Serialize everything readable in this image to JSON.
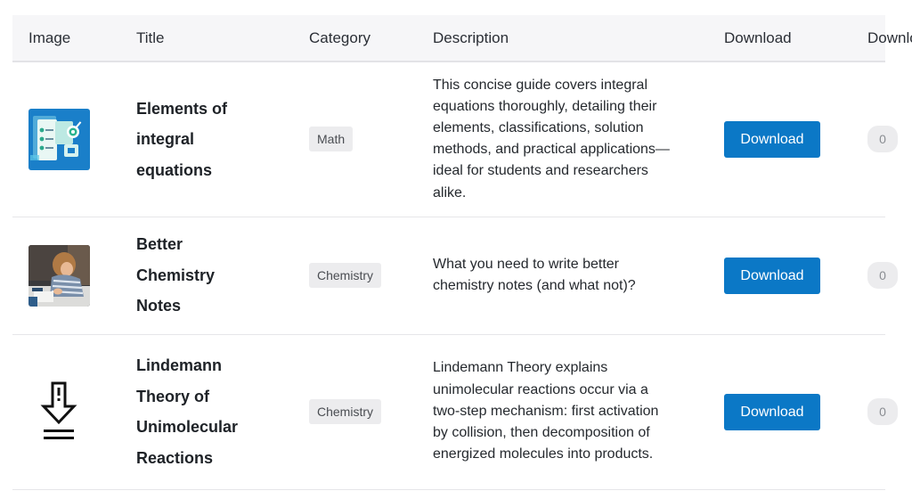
{
  "table": {
    "headers": {
      "image": "Image",
      "title": "Title",
      "category": "Category",
      "description": "Description",
      "download": "Download",
      "downloads": "Downloads"
    },
    "rows": [
      {
        "image_icon": "infographic-thumbnail",
        "title": "Elements of integral equations",
        "category": "Math",
        "description": "This concise guide covers integral equations thoroughly, detailing their elements, classifications, solution methods, and practical applications—ideal for students and researchers alike.",
        "download_label": "Download",
        "downloads": "0"
      },
      {
        "image_icon": "child-writing-photo-thumbnail",
        "title": "Better Chemistry Notes",
        "category": "Chemistry",
        "description": "What you need to write better chemistry notes (and what not)?",
        "download_label": "Download",
        "downloads": "0"
      },
      {
        "image_icon": "download-arrow-icon",
        "title": "Lindemann Theory of Unimolecular Reactions",
        "category": "Chemistry",
        "description": "Lindemann Theory explains unimolecular reactions occur via a two-step mechanism: first activation by collision, then decomposition of energized molecules into products.",
        "download_label": "Download",
        "downloads": "0"
      }
    ]
  },
  "colors": {
    "header_bg": "#f6f6f8",
    "button_bg": "#0b78c6",
    "badge_bg": "#ececee"
  }
}
